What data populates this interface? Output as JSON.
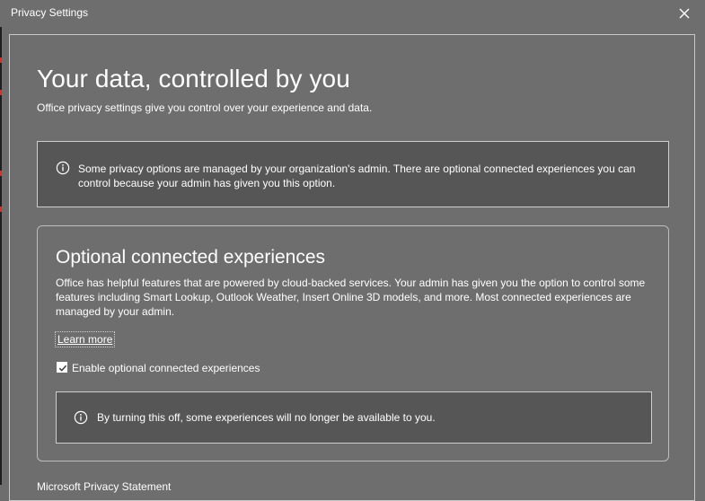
{
  "window": {
    "title": "Privacy Settings",
    "close_icon": "close-icon"
  },
  "main": {
    "heading": "Your data, controlled by you",
    "subtitle": "Office privacy settings give you control over your experience and data."
  },
  "notice": {
    "icon": "info-icon",
    "text": "Some privacy options are managed by your organization's admin. There are optional connected experiences you can control because your admin has given you this option."
  },
  "optional_experiences": {
    "title": "Optional connected experiences",
    "description": "Office has helpful features that are powered by cloud-backed services. Your admin has given you the option to control some features including Smart Lookup, Outlook Weather, Insert Online 3D models, and more. Most connected experiences are managed by your admin.",
    "learn_more": "Learn more",
    "checkbox_label": "Enable optional connected experiences",
    "checkbox_checked": true,
    "warning_icon": "info-icon",
    "warning_text": "By turning this off, some experiences will no longer be available to you."
  },
  "footer": {
    "link_text": "Microsoft Privacy Statement"
  },
  "colors": {
    "background": "#6e6e6e",
    "notice_background": "#565656",
    "text": "#ffffff",
    "border": "#cfcfcf"
  }
}
